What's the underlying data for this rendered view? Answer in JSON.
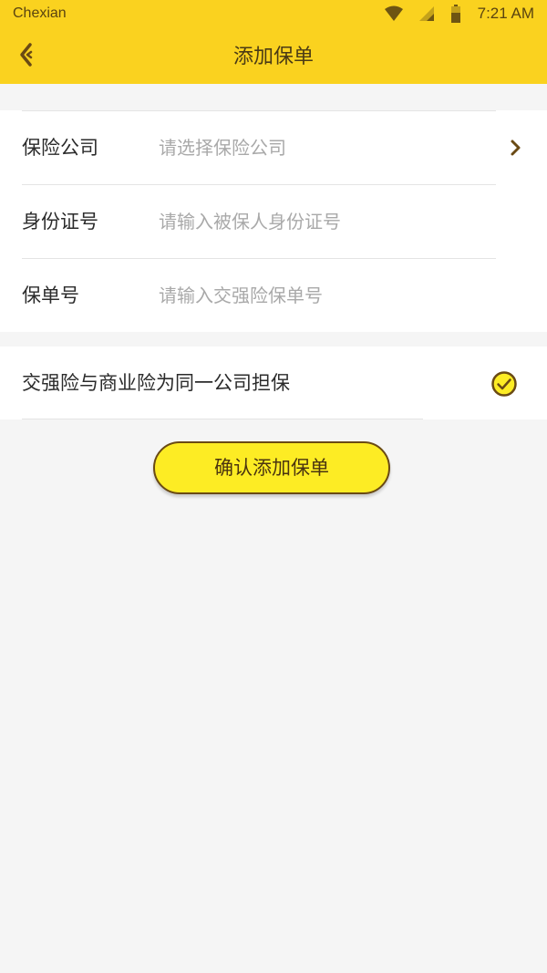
{
  "status_bar": {
    "carrier": "Chexian",
    "time": "7:21 AM",
    "icons": [
      "wifi-icon",
      "signal-icon",
      "battery-icon"
    ]
  },
  "nav": {
    "back_icon": "back-arrow-icon",
    "title": "添加保单"
  },
  "form": {
    "rows": [
      {
        "label": "保险公司",
        "placeholder": "请选择保险公司",
        "trailing_icon": "chevron-right-icon"
      },
      {
        "label": "身份证号",
        "placeholder": "请输入被保人身份证号"
      },
      {
        "label": "保单号",
        "placeholder": "请输入交强险保单号"
      }
    ]
  },
  "agreement": {
    "label": "交强险与商业险为同一公司担保",
    "checked": true,
    "icon": "check-circle-icon"
  },
  "confirm_button": {
    "label": "确认添加保单"
  },
  "colors": {
    "header_bg": "#fad21f",
    "button_bg": "#fdec24",
    "button_border": "#6a4a14",
    "page_bg": "#f5f5f5",
    "placeholder": "#a9a9a9",
    "check_color": "#6a4a14"
  }
}
